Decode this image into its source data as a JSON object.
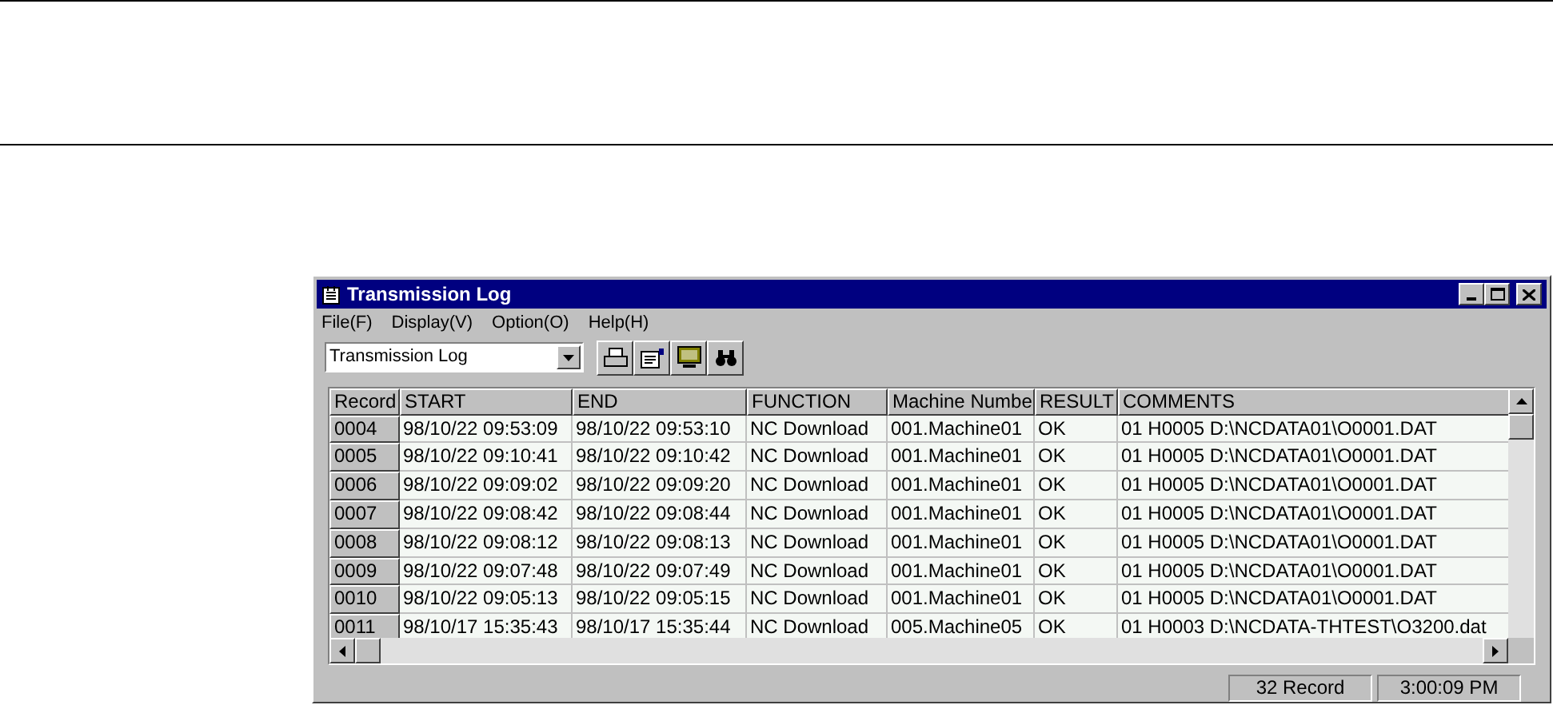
{
  "window": {
    "title": "Transmission Log"
  },
  "menu": [
    "File(F)",
    "Display(V)",
    "Option(O)",
    "Help(H)"
  ],
  "view_select": {
    "value": "Transmission Log"
  },
  "table": {
    "columns": [
      "Record",
      "START",
      "END",
      "FUNCTION",
      "Machine Numbe",
      "RESULT",
      "COMMENTS"
    ],
    "rows": [
      [
        "0004",
        "98/10/22 09:53:09",
        "98/10/22 09:53:10",
        "NC Download",
        "001.Machine01",
        "OK",
        "01 H0005 D:\\NCDATA01\\O0001.DAT"
      ],
      [
        "0005",
        "98/10/22 09:10:41",
        "98/10/22 09:10:42",
        "NC Download",
        "001.Machine01",
        "OK",
        "01 H0005 D:\\NCDATA01\\O0001.DAT"
      ],
      [
        "0006",
        "98/10/22 09:09:02",
        "98/10/22 09:09:20",
        "NC Download",
        "001.Machine01",
        "OK",
        "01 H0005 D:\\NCDATA01\\O0001.DAT"
      ],
      [
        "0007",
        "98/10/22 09:08:42",
        "98/10/22 09:08:44",
        "NC Download",
        "001.Machine01",
        "OK",
        "01 H0005 D:\\NCDATA01\\O0001.DAT"
      ],
      [
        "0008",
        "98/10/22 09:08:12",
        "98/10/22 09:08:13",
        "NC Download",
        "001.Machine01",
        "OK",
        "01 H0005 D:\\NCDATA01\\O0001.DAT"
      ],
      [
        "0009",
        "98/10/22 09:07:48",
        "98/10/22 09:07:49",
        "NC Download",
        "001.Machine01",
        "OK",
        "01 H0005 D:\\NCDATA01\\O0001.DAT"
      ],
      [
        "0010",
        "98/10/22 09:05:13",
        "98/10/22 09:05:15",
        "NC Download",
        "001.Machine01",
        "OK",
        "01 H0005 D:\\NCDATA01\\O0001.DAT"
      ],
      [
        "0011",
        "98/10/17 15:35:43",
        "98/10/17 15:35:44",
        "NC Download",
        "005.Machine05",
        "OK",
        "01 H0003 D:\\NCDATA-THTEST\\O3200.dat"
      ]
    ]
  },
  "status_bar": [
    "32 Record",
    "3:00:09 PM"
  ]
}
